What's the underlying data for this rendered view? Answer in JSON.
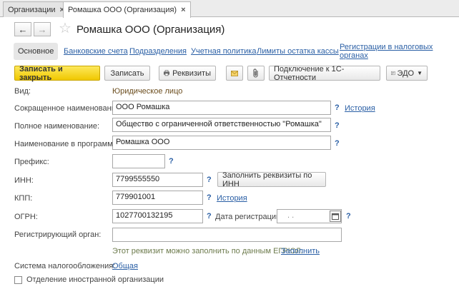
{
  "tabs": [
    {
      "label": "Организации",
      "close": "×"
    },
    {
      "label": "Ромашка ООО (Организация)",
      "close": "×"
    }
  ],
  "header": {
    "title": "Ромашка ООО (Организация)",
    "back": "←",
    "forward": "→",
    "star": "☆"
  },
  "sections": {
    "basic": "Основное",
    "bank": "Банковские счета",
    "divisions": "Подразделения",
    "policy": "Учетная политика",
    "cash_limits": "Лимиты остатка кассы",
    "tax_registration": "Регистрации в налоговых органах"
  },
  "toolbar": {
    "save_close": "Записать и закрыть",
    "save": "Записать",
    "requisites": "Реквизиты",
    "connect": "Подключение к 1С-Отчетности",
    "edo": "ЭДО"
  },
  "form": {
    "kind_label": "Вид:",
    "kind_value": "Юридическое лицо",
    "short_name_label": "Сокращенное наименование:",
    "short_name_value": "ООО Ромашка",
    "full_name_label": "Полное наименование:",
    "full_name_value": "Общество с ограниченной ответственностью \"Ромашка\"",
    "program_name_label": "Наименование в программе:",
    "program_name_value": "Ромашка ООО",
    "prefix_label": "Префикс:",
    "prefix_value": "",
    "inn_label": "ИНН:",
    "inn_value": "7799555550",
    "fill_by_inn": "Заполнить реквизиты по ИНН",
    "kpp_label": "КПП:",
    "kpp_value": "779901001",
    "ogrn_label": "ОГРН:",
    "ogrn_value": "1027700132195",
    "reg_date_label": "Дата регистрации:",
    "reg_date_value": ". .",
    "reg_authority_label": "Регистрирующий орган:",
    "reg_authority_value": "",
    "egrul_hint": "Этот реквизит можно заполнить по данным ЕГРЮЛ.",
    "fill_link": "Заполнить",
    "tax_system_label": "Система налогообложения:",
    "tax_system_value": "Общая",
    "foreign_branch_label": "Отделение иностранной организации",
    "history": "История",
    "help": "?"
  }
}
